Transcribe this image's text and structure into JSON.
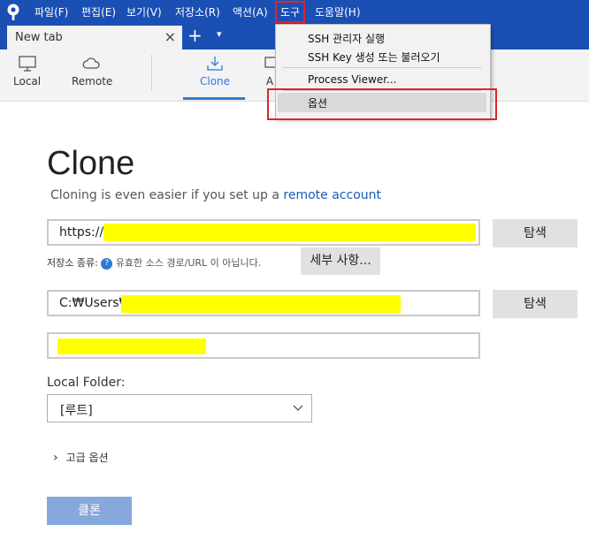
{
  "menu": {
    "items": [
      "파일(F)",
      "편집(E)",
      "보기(V)",
      "저장소(R)",
      "액션(A)",
      "도구",
      "도움말(H)"
    ]
  },
  "tabs": {
    "active_label": "New tab",
    "close": "×",
    "add": "+",
    "more": "▾"
  },
  "toolbar": {
    "local_label": "Local",
    "remote_label": "Remote",
    "clone_label": "Clone",
    "partial_label": "A"
  },
  "tools_menu": {
    "items": [
      "SSH 관리자 실행",
      "SSH Key 생성 또는 불러오기",
      "Process Viewer...",
      "옵션"
    ]
  },
  "clone_page": {
    "title": "Clone",
    "subtitle_prefix": "Cloning is even easier if you set up a ",
    "subtitle_link": "remote account",
    "source_url_value": "https://",
    "browse_label": "탐색",
    "repo_type_label": "저장소 종류:",
    "repo_type_help": "?",
    "repo_type_status": "유효한 소스 경로/URL 이 아닙니다.",
    "details_button": "세부 사항...",
    "dest_path_value": "C:₩Users₩",
    "browse2_label": "탐색",
    "local_folder_label": "Local Folder:",
    "local_folder_value": "[루트]",
    "advanced_label": "고급 옵션",
    "advanced_chevron": "›",
    "clone_button": "클론"
  },
  "colors": {
    "menubar": "#1a4fb4",
    "accent": "#2a7bd6",
    "highlight_box": "#e0242a",
    "redaction": "#ffff00",
    "clone_button": "#86a8dc"
  }
}
